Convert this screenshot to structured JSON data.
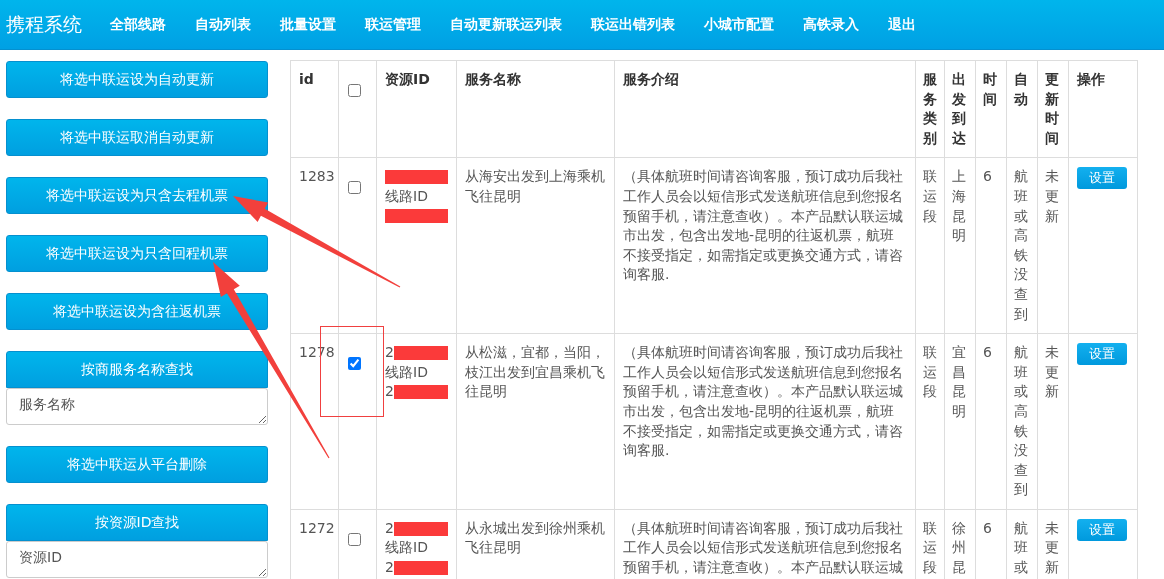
{
  "navbar": {
    "brand": "携程系统",
    "items": [
      "全部线路",
      "自动列表",
      "批量设置",
      "联运管理",
      "自动更新联运列表",
      "联运出错列表",
      "小城市配置",
      "高铁录入",
      "退出"
    ]
  },
  "sidebar": {
    "items": [
      {
        "kind": "button",
        "label": "将选中联运设为自动更新"
      },
      {
        "kind": "button",
        "label": "将选中联运取消自动更新"
      },
      {
        "kind": "button",
        "label": "将选中联运设为只含去程机票"
      },
      {
        "kind": "button",
        "label": "将选中联运设为只含回程机票"
      },
      {
        "kind": "button",
        "label": "将选中联运设为含往返机票"
      },
      {
        "kind": "search",
        "label": "按商服务名称查找",
        "placeholder": "服务名称"
      },
      {
        "kind": "button",
        "label": "将选中联运从平台删除"
      },
      {
        "kind": "search",
        "label": "按资源ID查找",
        "placeholder": "资源ID"
      }
    ]
  },
  "table": {
    "columns": [
      {
        "kind": "text",
        "label": "id"
      },
      {
        "kind": "checkbox",
        "checked": false
      },
      {
        "kind": "text",
        "label": "资源ID"
      },
      {
        "kind": "text",
        "label": "服务名称"
      },
      {
        "kind": "text",
        "label": "服务介绍"
      },
      {
        "kind": "text",
        "label": "服务类别"
      },
      {
        "kind": "text",
        "label": "出发到达"
      },
      {
        "kind": "text",
        "label": "时间"
      },
      {
        "kind": "text",
        "label": "自动"
      },
      {
        "kind": "text",
        "label": "更新时间"
      },
      {
        "kind": "text",
        "label": "操作"
      }
    ],
    "rows": [
      {
        "id": "1283",
        "checked": false,
        "resource_id": [
          {
            "redacted": true
          },
          {
            "text": "线路ID",
            "redacted": false
          },
          {
            "redacted": true
          }
        ],
        "name": "从海安出发到上海乘机飞往昆明",
        "intro": "（具体航班时间请咨询客服，预订成功后我社工作人员会以短信形式发送航班信息到您报名预留手机，请注意查收）。本产品默认联运城市出发，包含出发地-昆明的往返机票，航班不接受指定，如需指定或更换交通方式，请咨询客服.",
        "category": "联运段",
        "route": "上海昆明",
        "time": "6",
        "auto": "航班或高铁没查到",
        "updated": "未更新",
        "action": "设置"
      },
      {
        "id": "1278",
        "checked": true,
        "resource_id": [
          {
            "text": "2",
            "redacted": true
          },
          {
            "text": "线路ID",
            "redacted": false
          },
          {
            "text": "2",
            "redacted": true
          }
        ],
        "name": "从松滋，宜都，当阳，枝江出发到宜昌乘机飞往昆明",
        "intro": "（具体航班时间请咨询客服，预订成功后我社工作人员会以短信形式发送航班信息到您报名预留手机，请注意查收）。本产品默认联运城市出发，包含出发地-昆明的往返机票，航班不接受指定，如需指定或更换交通方式，请咨询客服.",
        "category": "联运段",
        "route": "宜昌昆明",
        "time": "6",
        "auto": "航班或高铁没查到",
        "updated": "未更新",
        "action": "设置"
      },
      {
        "id": "1272",
        "checked": false,
        "resource_id": [
          {
            "text": "2",
            "redacted": true
          },
          {
            "text": "线路ID",
            "redacted": false
          },
          {
            "text": "2",
            "redacted": true
          }
        ],
        "name": "从永城出发到徐州乘机飞往昆明",
        "intro": "（具体航班时间请咨询客服，预订成功后我社工作人员会以短信形式发送航班信息到您报名预留手机，请注意查收）。本产品默认联运城",
        "category": "联运段",
        "route": "徐州昆",
        "time": "6",
        "auto": "航班或",
        "updated": "未更新",
        "action": "设置"
      }
    ]
  }
}
